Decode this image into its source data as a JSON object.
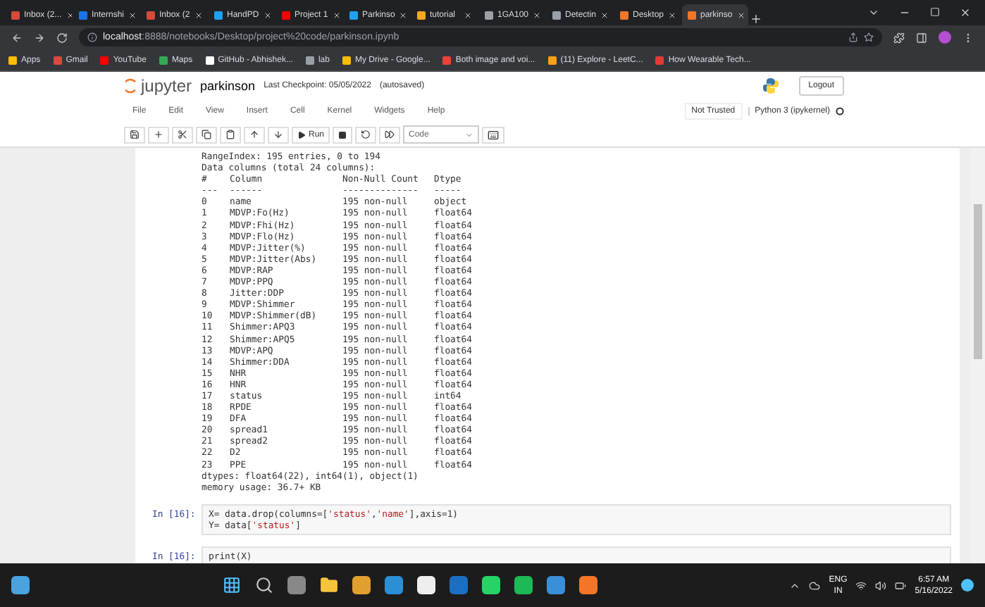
{
  "browser": {
    "tabs": [
      {
        "title": "Inbox (2...",
        "selected": false,
        "color": "#d54b3d"
      },
      {
        "title": "Internshi",
        "selected": false,
        "color": "#1a73e8"
      },
      {
        "title": "Inbox (2",
        "selected": false,
        "color": "#d54b3d"
      },
      {
        "title": "HandPD",
        "selected": false,
        "color": "#1da1f2"
      },
      {
        "title": "Project 1",
        "selected": false,
        "color": "#ff0000"
      },
      {
        "title": "Parkinso",
        "selected": false,
        "color": "#1da1f2"
      },
      {
        "title": "tutorial",
        "selected": false,
        "color": "#f5a623"
      },
      {
        "title": "1GA100",
        "selected": false,
        "color": "#9aa0a6"
      },
      {
        "title": "Detectin",
        "selected": false,
        "color": "#9aa0a6"
      },
      {
        "title": "Desktop",
        "selected": false,
        "color": "#f37626"
      },
      {
        "title": "parkinso",
        "selected": true,
        "color": "#f37626"
      }
    ],
    "address": {
      "host": "localhost",
      "path": ":8888/notebooks/Desktop/project%20code/parkinson.ipynb"
    },
    "bookmarks": [
      {
        "label": "Apps",
        "color": "#fbbc04"
      },
      {
        "label": "Gmail",
        "color": "#d54b3d"
      },
      {
        "label": "YouTube",
        "color": "#ff0000"
      },
      {
        "label": "Maps",
        "color": "#34a853"
      },
      {
        "label": "GitHub - Abhishek...",
        "color": "#ffffff"
      },
      {
        "label": "lab",
        "color": "#9aa0a6"
      },
      {
        "label": "My Drive - Google...",
        "color": "#fbbc04"
      },
      {
        "label": "Both image and voi...",
        "color": "#ea4335"
      },
      {
        "label": "(11) Explore - LeetC...",
        "color": "#f89f1b"
      },
      {
        "label": "How Wearable Tech...",
        "color": "#e53935"
      }
    ]
  },
  "notebook": {
    "logo": "jupyter",
    "name": "parkinson",
    "checkpoint": "Last Checkpoint: 05/05/2022",
    "autosaved": "(autosaved)",
    "logout": "Logout",
    "menu": [
      "File",
      "Edit",
      "View",
      "Insert",
      "Cell",
      "Kernel",
      "Widgets",
      "Help"
    ],
    "trusted": "Not Trusted",
    "kernel": "Python 3 (ipykernel)",
    "run": "Run",
    "cell_type": "Code",
    "output": {
      "lines": [
        "RangeIndex: 195 entries, 0 to 194",
        "Data columns (total 24 columns):"
      ],
      "header": [
        "#",
        "Column",
        "Non-Null Count",
        "Dtype"
      ],
      "rule": [
        "---",
        "------",
        "--------------",
        "-----"
      ],
      "rows": [
        [
          "0",
          "name",
          "195 non-null",
          "object"
        ],
        [
          "1",
          "MDVP:Fo(Hz)",
          "195 non-null",
          "float64"
        ],
        [
          "2",
          "MDVP:Fhi(Hz)",
          "195 non-null",
          "float64"
        ],
        [
          "3",
          "MDVP:Flo(Hz)",
          "195 non-null",
          "float64"
        ],
        [
          "4",
          "MDVP:Jitter(%)",
          "195 non-null",
          "float64"
        ],
        [
          "5",
          "MDVP:Jitter(Abs)",
          "195 non-null",
          "float64"
        ],
        [
          "6",
          "MDVP:RAP",
          "195 non-null",
          "float64"
        ],
        [
          "7",
          "MDVP:PPQ",
          "195 non-null",
          "float64"
        ],
        [
          "8",
          "Jitter:DDP",
          "195 non-null",
          "float64"
        ],
        [
          "9",
          "MDVP:Shimmer",
          "195 non-null",
          "float64"
        ],
        [
          "10",
          "MDVP:Shimmer(dB)",
          "195 non-null",
          "float64"
        ],
        [
          "11",
          "Shimmer:APQ3",
          "195 non-null",
          "float64"
        ],
        [
          "12",
          "Shimmer:APQ5",
          "195 non-null",
          "float64"
        ],
        [
          "13",
          "MDVP:APQ",
          "195 non-null",
          "float64"
        ],
        [
          "14",
          "Shimmer:DDA",
          "195 non-null",
          "float64"
        ],
        [
          "15",
          "NHR",
          "195 non-null",
          "float64"
        ],
        [
          "16",
          "HNR",
          "195 non-null",
          "float64"
        ],
        [
          "17",
          "status",
          "195 non-null",
          "int64"
        ],
        [
          "18",
          "RPDE",
          "195 non-null",
          "float64"
        ],
        [
          "19",
          "DFA",
          "195 non-null",
          "float64"
        ],
        [
          "20",
          "spread1",
          "195 non-null",
          "float64"
        ],
        [
          "21",
          "spread2",
          "195 non-null",
          "float64"
        ],
        [
          "22",
          "D2",
          "195 non-null",
          "float64"
        ],
        [
          "23",
          "PPE",
          "195 non-null",
          "float64"
        ]
      ],
      "footer": [
        "dtypes: float64(22), int64(1), object(1)",
        "memory usage: 36.7+ KB"
      ]
    },
    "cells": [
      {
        "prompt": "In [16]:",
        "lines": [
          [
            {
              "kind": "plain",
              "text": "X= data.drop(columns=["
            },
            {
              "kind": "string",
              "text": "'status'"
            },
            {
              "kind": "plain",
              "text": ","
            },
            {
              "kind": "string",
              "text": "'name'"
            },
            {
              "kind": "plain",
              "text": "],axis=1)"
            }
          ],
          [
            {
              "kind": "plain",
              "text": "Y= data["
            },
            {
              "kind": "string",
              "text": "'status'"
            },
            {
              "kind": "plain",
              "text": "]"
            }
          ]
        ]
      },
      {
        "prompt": "In [16]:",
        "lines": [
          [
            {
              "kind": "plain",
              "text": "print(X)"
            }
          ]
        ]
      }
    ]
  },
  "taskbar": {
    "language": "ENG",
    "region": "IN",
    "time": "6:57 AM",
    "date": "5/16/2022"
  }
}
